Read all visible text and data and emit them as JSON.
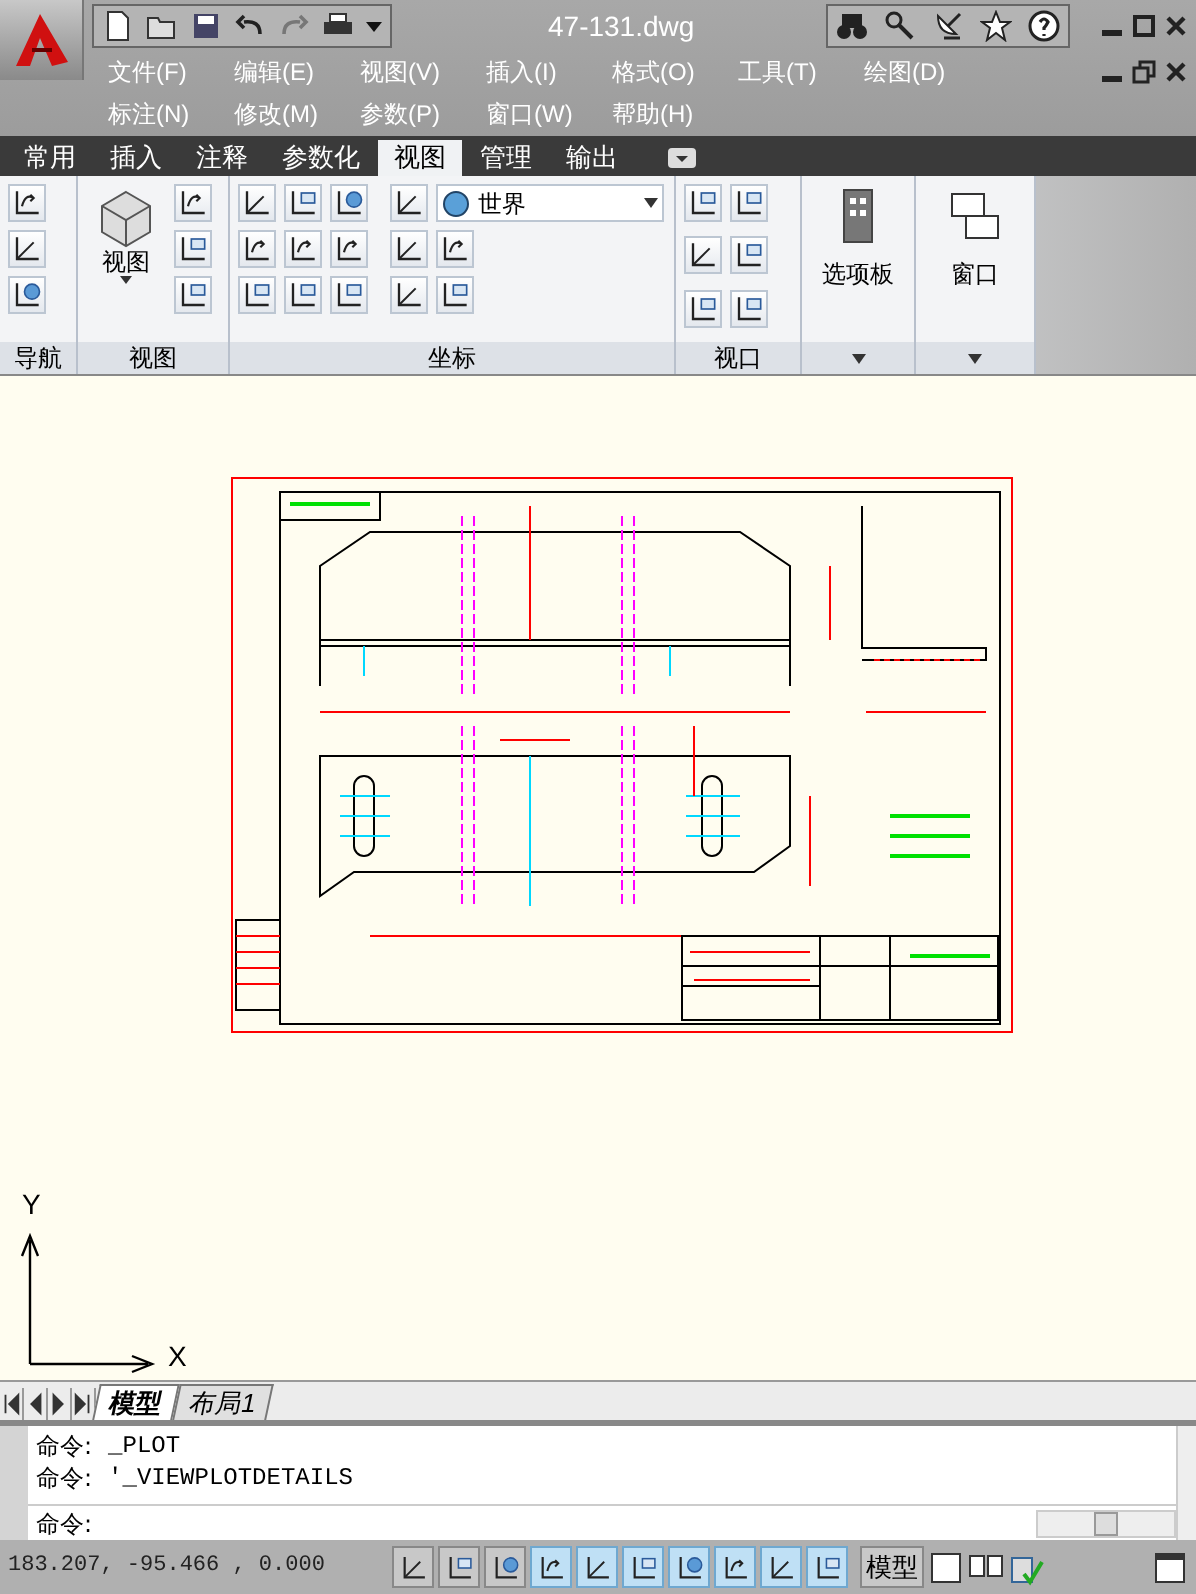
{
  "window": {
    "title": "47-131.dwg"
  },
  "menu_items": [
    "文件(F)",
    "编辑(E)",
    "视图(V)",
    "插入(I)",
    "格式(O)",
    "工具(T)",
    "绘图(D)",
    "标注(N)",
    "修改(M)",
    "参数(P)",
    "窗口(W)",
    "帮助(H)"
  ],
  "ribbon_tabs": [
    {
      "label": "常用",
      "selected": false
    },
    {
      "label": "插入",
      "selected": false
    },
    {
      "label": "注释",
      "selected": false
    },
    {
      "label": "参数化",
      "selected": false
    },
    {
      "label": "视图",
      "selected": true
    },
    {
      "label": "管理",
      "selected": false
    },
    {
      "label": "输出",
      "selected": false
    }
  ],
  "ribbon": {
    "view_button": "视图",
    "ucs_dropdown": "世界",
    "palettes_button": "选项板",
    "window_button": "窗口",
    "panels": [
      "导航",
      "视图",
      "坐标",
      "视口"
    ]
  },
  "ucs_icon": {
    "x_label": "X",
    "y_label": "Y"
  },
  "layout_tabs": [
    {
      "label": "模型",
      "selected": true
    },
    {
      "label": "布局1",
      "selected": false
    }
  ],
  "command": {
    "history": [
      {
        "prompt": "命令:",
        "text": "_PLOT"
      },
      {
        "prompt": "命令:",
        "text": "'_VIEWPLOTDETAILS"
      }
    ],
    "prompt": "命令:"
  },
  "status_bar": {
    "coordinates": "183.207, -95.466 , 0.000",
    "model_button": "模型",
    "toggles": [
      {
        "on": false
      },
      {
        "on": false
      },
      {
        "on": false
      },
      {
        "on": true
      },
      {
        "on": true
      },
      {
        "on": true
      },
      {
        "on": true
      },
      {
        "on": true
      },
      {
        "on": true
      },
      {
        "on": true
      }
    ]
  }
}
